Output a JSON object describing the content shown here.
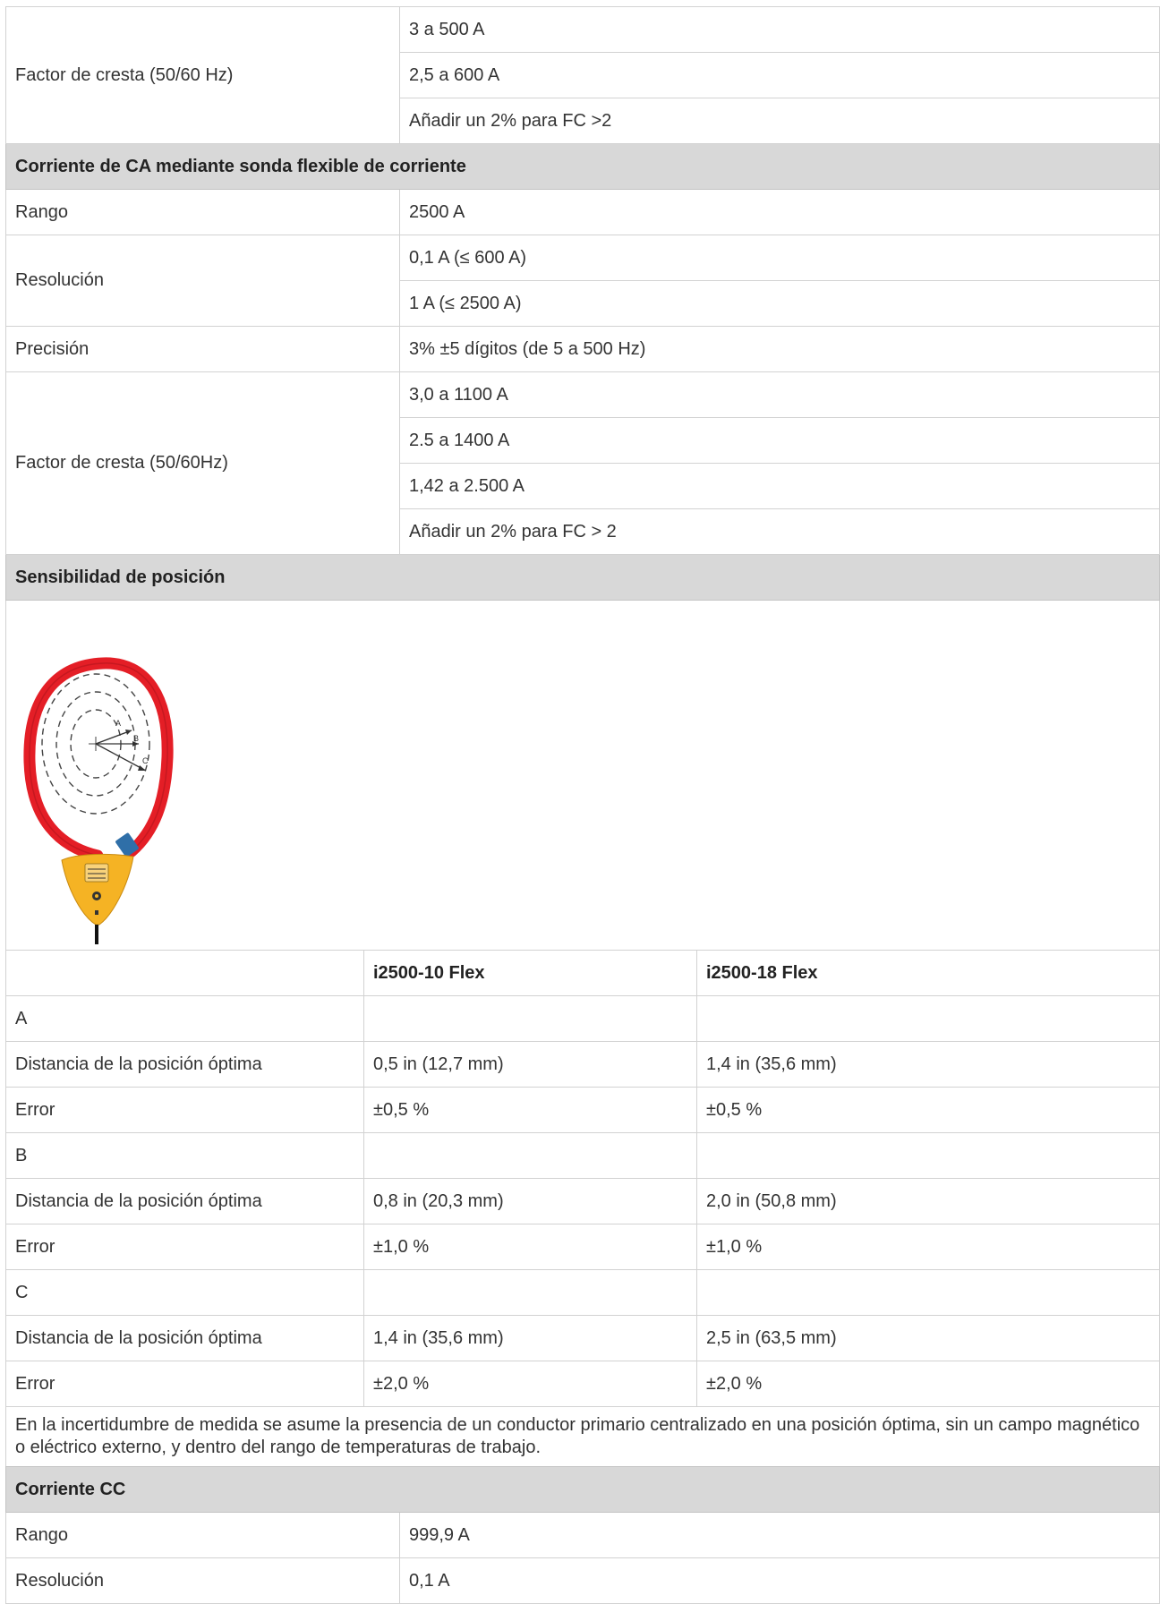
{
  "crest_top": {
    "label": "Factor de cresta (50/60 Hz)",
    "values": [
      "3 a 500 A",
      "2,5 a 600 A",
      "Añadir un 2% para FC >2"
    ]
  },
  "ac_flex": {
    "title": "Corriente de CA mediante sonda flexible de corriente",
    "range_label": "Rango",
    "range_value": "2500 A",
    "resolution_label": "Resolución",
    "resolution_values": [
      "0,1 A (≤ 600 A)",
      "1 A (≤ 2500 A)"
    ],
    "precision_label": "Precisión",
    "precision_value": "3% ±5 dígitos (de 5 a 500 Hz)",
    "crest_label": "Factor de cresta (50/60Hz)",
    "crest_values": [
      "3,0 a 1100 A",
      "2.5 a 1400 A",
      "1,42 a 2.500 A",
      "Añadir un 2% para FC > 2"
    ]
  },
  "position": {
    "title": "Sensibilidad de posición",
    "figure_labels": {
      "a": "A",
      "b": "B",
      "c": "C"
    },
    "columns": [
      "",
      "i2500-10 Flex",
      "i2500-18 Flex"
    ],
    "rows": [
      [
        "A",
        "",
        ""
      ],
      [
        "Distancia de la posición óptima",
        "0,5 in (12,7 mm)",
        "1,4 in (35,6 mm)"
      ],
      [
        "Error",
        "±0,5 %",
        "±0,5 %"
      ],
      [
        "B",
        "",
        ""
      ],
      [
        "Distancia de la posición óptima",
        "0,8 in (20,3 mm)",
        "2,0 in (50,8 mm)"
      ],
      [
        "Error",
        "±1,0 %",
        "±1,0 %"
      ],
      [
        "C",
        "",
        ""
      ],
      [
        "Distancia de la posición óptima",
        "1,4 in (35,6 mm)",
        "2,5 in (63,5 mm)"
      ],
      [
        "Error",
        "±2,0 %",
        "±2,0 %"
      ]
    ],
    "note": "En la incertidumbre de medida se asume la presencia de un conductor primario centralizado en una posición óptima, sin un campo magnético o eléctrico externo, y dentro del rango de temperaturas de trabajo."
  },
  "dc": {
    "title": "Corriente CC",
    "range_label": "Rango",
    "range_value": "999,9 A",
    "resolution_label": "Resolución",
    "resolution_value": "0,1 A"
  },
  "colors": {
    "probe_red": "#e41e26",
    "probe_yellow": "#f5b324",
    "probe_blue": "#2f6fa8",
    "header_gray": "#d8d8d8"
  }
}
